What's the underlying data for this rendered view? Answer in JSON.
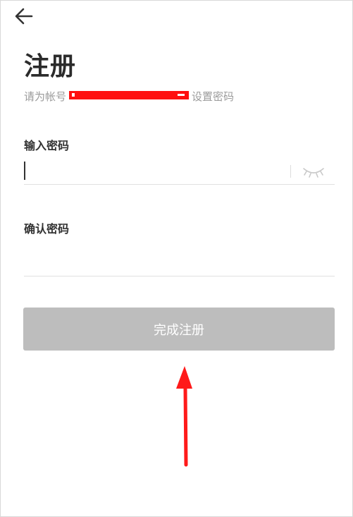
{
  "header": {
    "back_icon": "arrow-left-icon"
  },
  "page": {
    "title": "注册",
    "subtitle_prefix": "请为帐号",
    "subtitle_suffix": "设置密码"
  },
  "form": {
    "password_label": "输入密码",
    "password_value": "",
    "toggle_icon": "eye-closed-icon",
    "confirm_label": "确认密码",
    "confirm_value": "",
    "submit_label": "完成注册"
  },
  "annotation": {
    "arrow_icon": "red-arrow-up-icon",
    "arrow_color": "#ff1a1a",
    "redaction_color": "#ff1010"
  }
}
